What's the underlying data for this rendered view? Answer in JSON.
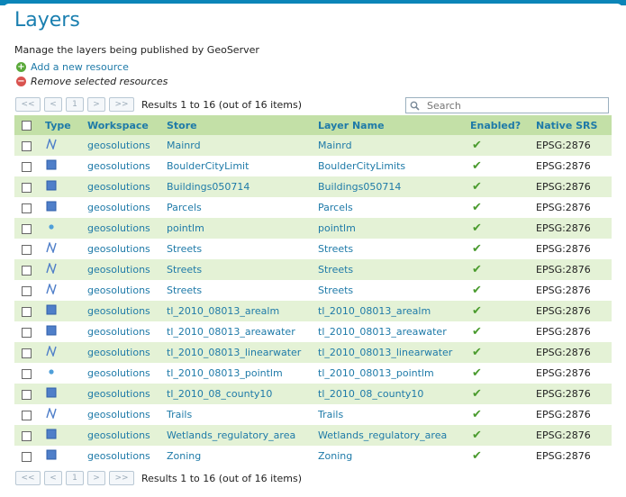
{
  "page": {
    "title": "Layers",
    "subtitle": "Manage the layers being published by GeoServer"
  },
  "actions": {
    "add_label": "Add a new resource",
    "remove_label": "Remove selected resources"
  },
  "pager": {
    "first": "<<",
    "prev": "<",
    "current": "1",
    "next": ">",
    "last": ">>",
    "results_text": "Results 1 to 16 (out of 16 items)"
  },
  "search": {
    "placeholder": "Search"
  },
  "table": {
    "headers": {
      "type": "Type",
      "workspace": "Workspace",
      "store": "Store",
      "layer_name": "Layer Name",
      "enabled": "Enabled?",
      "native_srs": "Native SRS"
    },
    "rows": [
      {
        "type": "line",
        "workspace": "geosolutions",
        "store": "Mainrd",
        "layer": "Mainrd",
        "enabled": true,
        "srs": "EPSG:2876"
      },
      {
        "type": "polygon",
        "workspace": "geosolutions",
        "store": "BoulderCityLimit",
        "layer": "BoulderCityLimits",
        "enabled": true,
        "srs": "EPSG:2876"
      },
      {
        "type": "polygon",
        "workspace": "geosolutions",
        "store": "Buildings050714",
        "layer": "Buildings050714",
        "enabled": true,
        "srs": "EPSG:2876"
      },
      {
        "type": "polygon",
        "workspace": "geosolutions",
        "store": "Parcels",
        "layer": "Parcels",
        "enabled": true,
        "srs": "EPSG:2876"
      },
      {
        "type": "point",
        "workspace": "geosolutions",
        "store": "pointlm",
        "layer": "pointlm",
        "enabled": true,
        "srs": "EPSG:2876"
      },
      {
        "type": "line",
        "workspace": "geosolutions",
        "store": "Streets",
        "layer": "Streets",
        "enabled": true,
        "srs": "EPSG:2876"
      },
      {
        "type": "line",
        "workspace": "geosolutions",
        "store": "Streets",
        "layer": "Streets",
        "enabled": true,
        "srs": "EPSG:2876"
      },
      {
        "type": "line",
        "workspace": "geosolutions",
        "store": "Streets",
        "layer": "Streets",
        "enabled": true,
        "srs": "EPSG:2876"
      },
      {
        "type": "polygon",
        "workspace": "geosolutions",
        "store": "tl_2010_08013_arealm",
        "layer": "tl_2010_08013_arealm",
        "enabled": true,
        "srs": "EPSG:2876"
      },
      {
        "type": "polygon",
        "workspace": "geosolutions",
        "store": "tl_2010_08013_areawater",
        "layer": "tl_2010_08013_areawater",
        "enabled": true,
        "srs": "EPSG:2876"
      },
      {
        "type": "line",
        "workspace": "geosolutions",
        "store": "tl_2010_08013_linearwater",
        "layer": "tl_2010_08013_linearwater",
        "enabled": true,
        "srs": "EPSG:2876"
      },
      {
        "type": "point",
        "workspace": "geosolutions",
        "store": "tl_2010_08013_pointlm",
        "layer": "tl_2010_08013_pointlm",
        "enabled": true,
        "srs": "EPSG:2876"
      },
      {
        "type": "polygon",
        "workspace": "geosolutions",
        "store": "tl_2010_08_county10",
        "layer": "tl_2010_08_county10",
        "enabled": true,
        "srs": "EPSG:2876"
      },
      {
        "type": "line",
        "workspace": "geosolutions",
        "store": "Trails",
        "layer": "Trails",
        "enabled": true,
        "srs": "EPSG:2876"
      },
      {
        "type": "polygon",
        "workspace": "geosolutions",
        "store": "Wetlands_regulatory_area",
        "layer": "Wetlands_regulatory_area",
        "enabled": true,
        "srs": "EPSG:2876"
      },
      {
        "type": "polygon",
        "workspace": "geosolutions",
        "store": "Zoning",
        "layer": "Zoning",
        "enabled": true,
        "srs": "EPSG:2876"
      }
    ]
  },
  "icons": {
    "add": "add-icon",
    "remove": "remove-icon",
    "search": "search-icon",
    "enabled": "checkmark-icon",
    "type_line": "line-layer-icon",
    "type_polygon": "polygon-layer-icon",
    "type_point": "point-layer-icon"
  },
  "colors": {
    "header_bg": "#c3e0a7",
    "row_alt_bg": "#e4f2d6",
    "link": "#1e7aa8",
    "title": "#1a7fb0",
    "top_bar": "#0b85b8"
  }
}
